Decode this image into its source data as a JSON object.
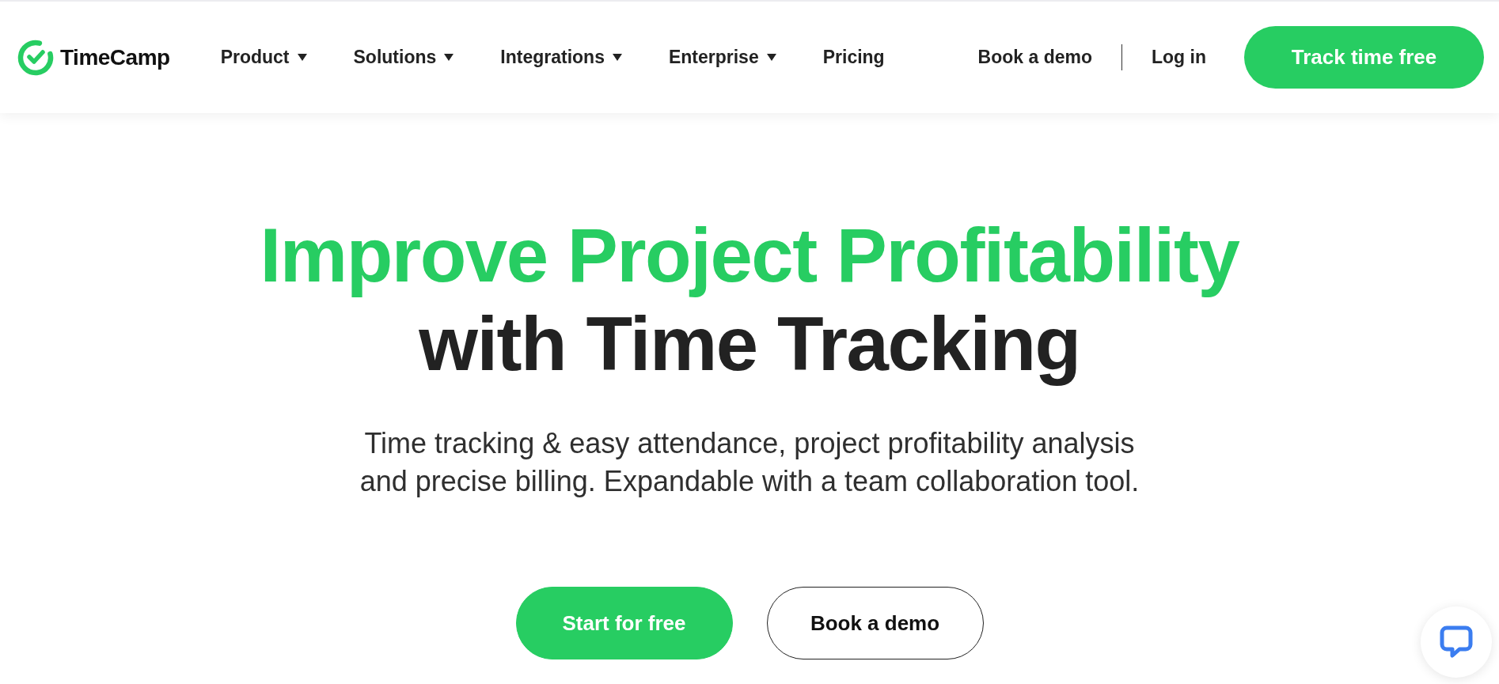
{
  "header": {
    "logo": {
      "text": "TimeCamp"
    },
    "nav": [
      {
        "label": "Product",
        "dropdown": true
      },
      {
        "label": "Solutions",
        "dropdown": true
      },
      {
        "label": "Integrations",
        "dropdown": true
      },
      {
        "label": "Enterprise",
        "dropdown": true
      },
      {
        "label": "Pricing",
        "dropdown": false
      }
    ],
    "links": [
      {
        "label": "Book a demo"
      },
      {
        "label": "Log in"
      }
    ],
    "cta": {
      "label": "Track time free"
    }
  },
  "hero": {
    "title": [
      {
        "text": "Improve Project Profitability",
        "highlight": true
      },
      {
        "text": "with Time Tracking",
        "highlight": false
      }
    ],
    "subtitle": "Time tracking & easy attendance, project profitability analysis and precise billing. Expandable with a team collaboration tool.",
    "buttons": [
      {
        "label": "Start for free",
        "kind": "primary"
      },
      {
        "label": "Book a demo",
        "kind": "outline"
      }
    ]
  }
}
